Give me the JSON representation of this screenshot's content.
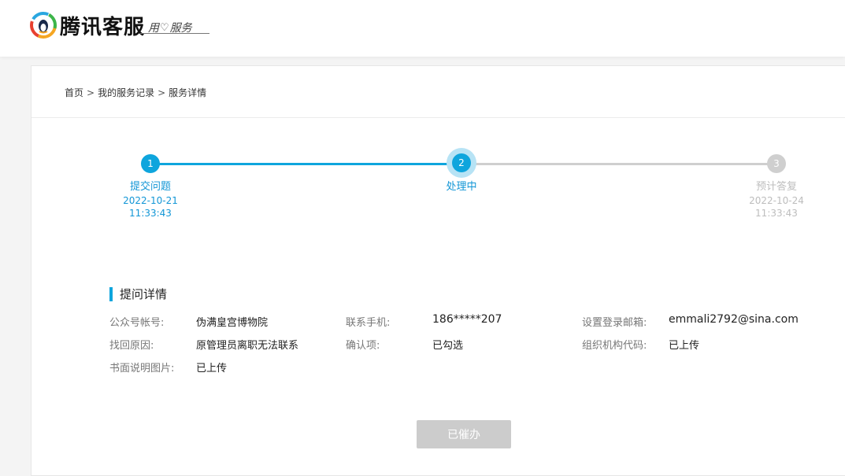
{
  "header": {
    "logo_text": "腾讯客服",
    "slogan_left": "用",
    "slogan_right": "服务"
  },
  "breadcrumb": {
    "items": [
      "首页",
      "我的服务记录",
      "服务详情"
    ],
    "separator": ">"
  },
  "stepper": {
    "steps": [
      {
        "number": "1",
        "label": "提交问题",
        "date": "2022-10-21",
        "time": "11:33:43",
        "state": "done"
      },
      {
        "number": "2",
        "label": "处理中",
        "date": "",
        "time": "",
        "state": "current"
      },
      {
        "number": "3",
        "label": "预计答复",
        "date": "2022-10-24",
        "time": "11:33:43",
        "state": "pending"
      }
    ]
  },
  "details": {
    "title": "提问详情",
    "fields": [
      {
        "label": "公众号帐号:",
        "value": "伪满皇宫博物院"
      },
      {
        "label": "联系手机:",
        "value": "186*****207"
      },
      {
        "label": "设置登录邮箱:",
        "value": "emmali2792@sina.com"
      },
      {
        "label": "找回原因:",
        "value": "原管理员离职无法联系"
      },
      {
        "label": "确认项:",
        "value": "已勾选"
      },
      {
        "label": "组织机构代码:",
        "value": "已上传"
      },
      {
        "label": "书面说明图片:",
        "value": "已上传"
      }
    ]
  },
  "actions": {
    "urge_button": "已催办"
  },
  "colors": {
    "accent": "#0ea5dd",
    "inactive": "#cfcfcf",
    "button_disabled": "#cccccc"
  }
}
